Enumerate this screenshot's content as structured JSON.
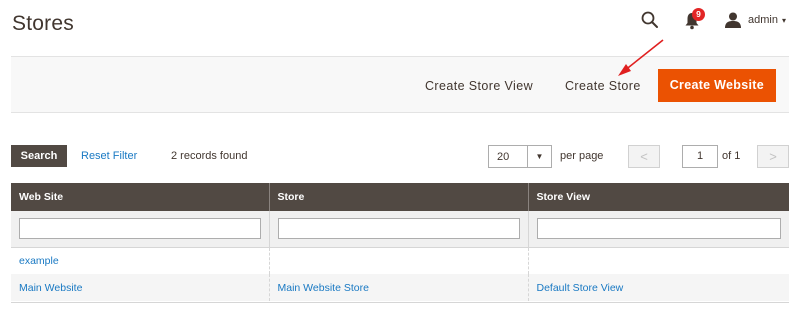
{
  "page": {
    "title": "Stores"
  },
  "header": {
    "search_icon": "search-icon",
    "notifications": {
      "icon": "bell-icon",
      "count": "9"
    },
    "user": {
      "icon": "user-icon",
      "label": "admin",
      "caret": "▾"
    }
  },
  "actions": {
    "create_store_view": "Create Store View",
    "create_store": "Create Store",
    "create_website": "Create Website"
  },
  "toolbar": {
    "search_label": "Search",
    "reset_filter_label": "Reset Filter",
    "records_found": "2 records found",
    "per_page_value": "20",
    "per_page_arrow": "▼",
    "per_page_label": "per page",
    "prev_label": "<",
    "next_label": ">",
    "current_page": "1",
    "page_of": "of 1"
  },
  "grid": {
    "columns": [
      "Web Site",
      "Store",
      "Store View"
    ],
    "rows": [
      {
        "website": "example",
        "store": "",
        "store_view": ""
      },
      {
        "website": "Main Website",
        "store": "Main Website Store",
        "store_view": "Default Store View"
      }
    ]
  },
  "colors": {
    "primary_button": "#eb5202",
    "header_dark": "#514943",
    "link": "#1979c3",
    "notification_badge": "#e22626",
    "annotation_arrow": "#e02020"
  }
}
